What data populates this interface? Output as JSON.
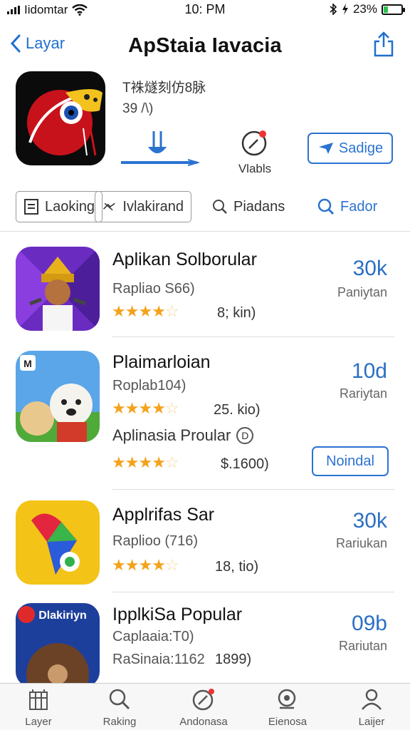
{
  "status_bar": {
    "carrier": "Iidomtar",
    "time": "10: PM",
    "battery": "23%",
    "battery_level": 0.23
  },
  "nav": {
    "back_label": "Layar",
    "title": "ApStaia Iavacia"
  },
  "app_header": {
    "line1": "T袾燧刻仿8脉",
    "line2": "39 /\\)",
    "views_label": "Vlabls",
    "save_label": "Sadige",
    "accent": "#2b73d1"
  },
  "tabs": [
    {
      "label": "Laoking",
      "icon": "list-icon"
    },
    {
      "label": "Ivlakirand",
      "icon": "arrow-icon"
    },
    {
      "label": "Piadans",
      "icon": "search-icon"
    },
    {
      "label": "Fador",
      "icon": "search-icon"
    }
  ],
  "apps": [
    {
      "name": "Aplikan Solborular",
      "sub": "Rapliao S66)",
      "rating": 4.5,
      "count": "8; kin)",
      "num": "30k",
      "cap": "Paniytan"
    },
    {
      "name": "Plaimarloian",
      "sub": "Roplab104)",
      "rating": 4.5,
      "count": "25. kio)",
      "num": "10d",
      "cap": "Rariytan",
      "extra_name": "Aplinasia Proular",
      "extra_badge": "D",
      "extra_rating": 4.5,
      "extra_count": "$.1600)",
      "install_label": "Noindal"
    },
    {
      "name": "Applrifas Sar",
      "sub": "Raplioo (716)",
      "rating": 4.5,
      "count": "18, tio)",
      "num": "30k",
      "cap": "Rariukan"
    },
    {
      "name": "IpplkiSa Popular",
      "sub": "Caplaaia:T0)",
      "sub2": "RaSinaia:1162",
      "count2": "1899)",
      "num": "09b",
      "cap": "Rariutan",
      "banner": "Dlakiriyn"
    }
  ],
  "tabbar": [
    {
      "label": "Layer",
      "icon": "building-icon"
    },
    {
      "label": "Raking",
      "icon": "search-icon"
    },
    {
      "label": "Andonasa",
      "icon": "compass-icon"
    },
    {
      "label": "Eienosa",
      "icon": "eye-search-icon"
    },
    {
      "label": "Laijer",
      "icon": "person-icon"
    }
  ]
}
